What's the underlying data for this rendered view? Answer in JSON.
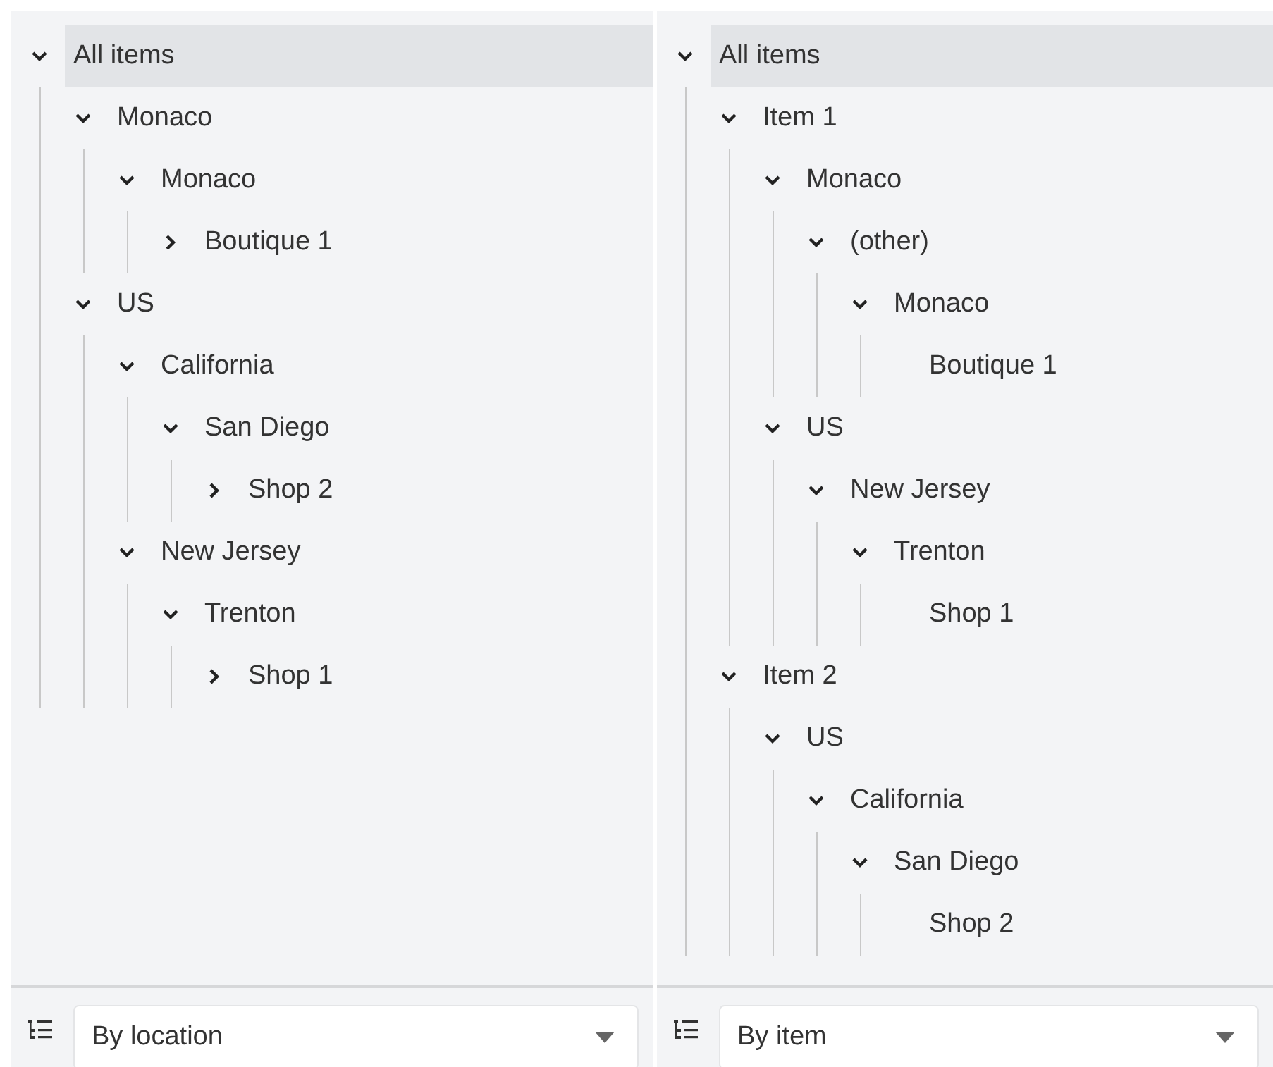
{
  "panels": [
    {
      "tree": [
        {
          "label": "All items",
          "kind": "branch",
          "expanded": true,
          "selected": true,
          "children": [
            {
              "label": "Monaco",
              "kind": "branch",
              "expanded": true,
              "selected": false,
              "children": [
                {
                  "label": "Monaco",
                  "kind": "branch",
                  "expanded": true,
                  "selected": false,
                  "children": [
                    {
                      "label": "Boutique 1",
                      "kind": "branch",
                      "expanded": false,
                      "selected": false
                    }
                  ]
                }
              ]
            },
            {
              "label": "US",
              "kind": "branch",
              "expanded": true,
              "selected": false,
              "children": [
                {
                  "label": "California",
                  "kind": "branch",
                  "expanded": true,
                  "selected": false,
                  "children": [
                    {
                      "label": "San Diego",
                      "kind": "branch",
                      "expanded": true,
                      "selected": false,
                      "children": [
                        {
                          "label": "Shop 2",
                          "kind": "branch",
                          "expanded": false,
                          "selected": false
                        }
                      ]
                    }
                  ]
                },
                {
                  "label": "New Jersey",
                  "kind": "branch",
                  "expanded": true,
                  "selected": false,
                  "children": [
                    {
                      "label": "Trenton",
                      "kind": "branch",
                      "expanded": true,
                      "selected": false,
                      "children": [
                        {
                          "label": "Shop 1",
                          "kind": "branch",
                          "expanded": false,
                          "selected": false
                        }
                      ]
                    }
                  ]
                }
              ]
            }
          ]
        }
      ],
      "grouping": {
        "value": "By location"
      }
    },
    {
      "tree": [
        {
          "label": "All items",
          "kind": "branch",
          "expanded": true,
          "selected": true,
          "children": [
            {
              "label": "Item 1",
              "kind": "branch",
              "expanded": true,
              "selected": false,
              "children": [
                {
                  "label": "Monaco",
                  "kind": "branch",
                  "expanded": true,
                  "selected": false,
                  "children": [
                    {
                      "label": "(other)",
                      "kind": "branch",
                      "expanded": true,
                      "selected": false,
                      "children": [
                        {
                          "label": "Monaco",
                          "kind": "branch",
                          "expanded": true,
                          "selected": false,
                          "children": [
                            {
                              "label": "Boutique 1",
                              "kind": "leaf",
                              "selected": false
                            }
                          ]
                        }
                      ]
                    }
                  ]
                },
                {
                  "label": "US",
                  "kind": "branch",
                  "expanded": true,
                  "selected": false,
                  "children": [
                    {
                      "label": "New Jersey",
                      "kind": "branch",
                      "expanded": true,
                      "selected": false,
                      "children": [
                        {
                          "label": "Trenton",
                          "kind": "branch",
                          "expanded": true,
                          "selected": false,
                          "children": [
                            {
                              "label": "Shop 1",
                              "kind": "leaf",
                              "selected": false
                            }
                          ]
                        }
                      ]
                    }
                  ]
                }
              ]
            },
            {
              "label": "Item 2",
              "kind": "branch",
              "expanded": true,
              "selected": false,
              "children": [
                {
                  "label": "US",
                  "kind": "branch",
                  "expanded": true,
                  "selected": false,
                  "children": [
                    {
                      "label": "California",
                      "kind": "branch",
                      "expanded": true,
                      "selected": false,
                      "children": [
                        {
                          "label": "San Diego",
                          "kind": "branch",
                          "expanded": true,
                          "selected": false,
                          "children": [
                            {
                              "label": "Shop 2",
                              "kind": "leaf",
                              "selected": false
                            }
                          ]
                        }
                      ]
                    }
                  ]
                }
              ]
            }
          ]
        }
      ],
      "grouping": {
        "value": "By item"
      }
    }
  ]
}
